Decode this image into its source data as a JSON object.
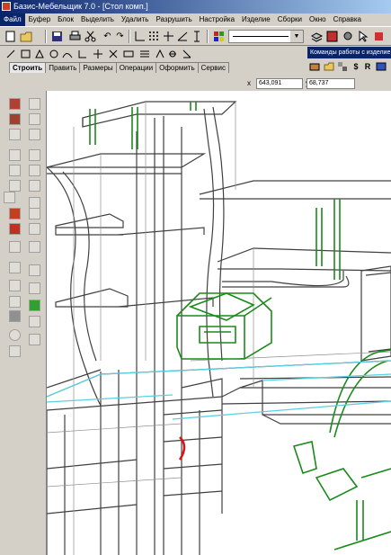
{
  "window": {
    "title": "Базис-Мебельщик 7.0 - [Стол комп.]"
  },
  "menu": {
    "items": [
      "Файл",
      "Буфер",
      "Блок",
      "Выделить",
      "Удалить",
      "Разрушить",
      "Настройка",
      "Изделие",
      "Сборки",
      "Окно",
      "Справка"
    ],
    "active_index": 0
  },
  "tabs": {
    "items": [
      "Строить",
      "Править",
      "Размеры",
      "Операции",
      "Оформить",
      "Сервис"
    ],
    "selected_index": 0
  },
  "coordinates": {
    "x": "643,091",
    "y": "68,737"
  },
  "command_panel": {
    "title": "Команды работы с изделие",
    "icon_dollar": "$",
    "icon_r": "R"
  },
  "toolbar": {
    "undo_icon": "↶",
    "redo_icon": "↷"
  },
  "colors": {
    "titlebar_start": "#0a246a",
    "titlebar_end": "#a6caf0",
    "chrome": "#d4d0c8",
    "model_lines": "#404040",
    "highlight_green": "#1a8a1a",
    "highlight_cyan": "#5ad0e0",
    "handle_red": "#e01010"
  }
}
